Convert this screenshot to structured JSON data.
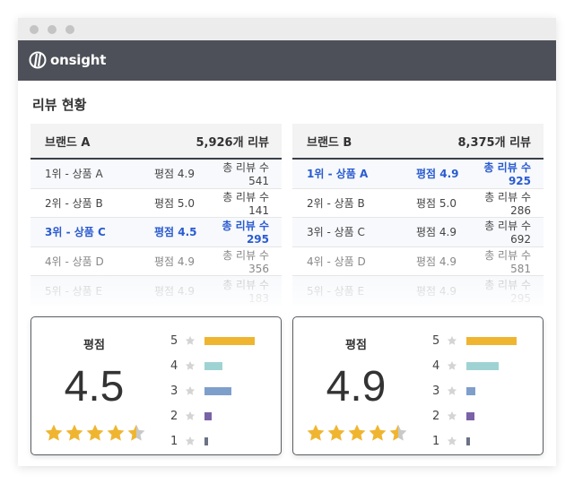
{
  "app": {
    "logo_text": "onsight"
  },
  "section_title": "리뷰 현황",
  "brands": [
    {
      "name": "브랜드 A",
      "review_count": "5,926개 리뷰",
      "rows": [
        {
          "rank": "1위 - 상품 A",
          "score": "평점 4.9",
          "total": "총 리뷰 수 541",
          "state": "normal"
        },
        {
          "rank": "2위 - 상품 B",
          "score": "평점 5.0",
          "total": "총 리뷰 수 141",
          "state": "normal"
        },
        {
          "rank": "3위 - 상품 C",
          "score": "평점 4.5",
          "total": "총 리뷰 수 295",
          "state": "active"
        },
        {
          "rank": "4위 - 상품 D",
          "score": "평점 4.9",
          "total": "총 리뷰 수 356",
          "state": "fade1"
        },
        {
          "rank": "5위 - 상품 E",
          "score": "평점 4.9",
          "total": "총 리뷰 수 183",
          "state": "fade2"
        }
      ],
      "rating": {
        "label": "평점",
        "score": "4.5",
        "stars": 4.5,
        "distribution": [
          {
            "star": "5",
            "fraction": 1.0,
            "color": "#f0b530"
          },
          {
            "star": "4",
            "fraction": 0.35,
            "color": "#9fd3d3"
          },
          {
            "star": "3",
            "fraction": 0.53,
            "color": "#7f9fcb"
          },
          {
            "star": "2",
            "fraction": 0.15,
            "color": "#7a62a6"
          },
          {
            "star": "1",
            "fraction": 0.08,
            "color": "#6b7285"
          }
        ]
      }
    },
    {
      "name": "브랜드 B",
      "review_count": "8,375개 리뷰",
      "rows": [
        {
          "rank": "1위 - 상품 A",
          "score": "평점 4.9",
          "total": "총 리뷰 수 925",
          "state": "active"
        },
        {
          "rank": "2위 - 상품 B",
          "score": "평점 5.0",
          "total": "총 리뷰 수 286",
          "state": "normal"
        },
        {
          "rank": "3위 - 상품 C",
          "score": "평점 4.9",
          "total": "총 리뷰 수 692",
          "state": "normal"
        },
        {
          "rank": "4위 - 상품 D",
          "score": "평점 4.9",
          "total": "총 리뷰 수 581",
          "state": "fade1"
        },
        {
          "rank": "5위 - 상품 E",
          "score": "평점 4.9",
          "total": "총 리뷰 수 295",
          "state": "fade2"
        }
      ],
      "rating": {
        "label": "평점",
        "score": "4.9",
        "stars": 4.5,
        "distribution": [
          {
            "star": "5",
            "fraction": 1.0,
            "color": "#f0b530"
          },
          {
            "star": "4",
            "fraction": 0.64,
            "color": "#9fd3d3"
          },
          {
            "star": "3",
            "fraction": 0.18,
            "color": "#7f9fcb"
          },
          {
            "star": "2",
            "fraction": 0.16,
            "color": "#7a62a6"
          },
          {
            "star": "1",
            "fraction": 0.08,
            "color": "#6b7285"
          }
        ]
      }
    }
  ],
  "colors": {
    "accent": "#2a5bd0",
    "appbar": "#4d5058",
    "star": "#f0b530",
    "star_empty": "#c9c9c9"
  }
}
